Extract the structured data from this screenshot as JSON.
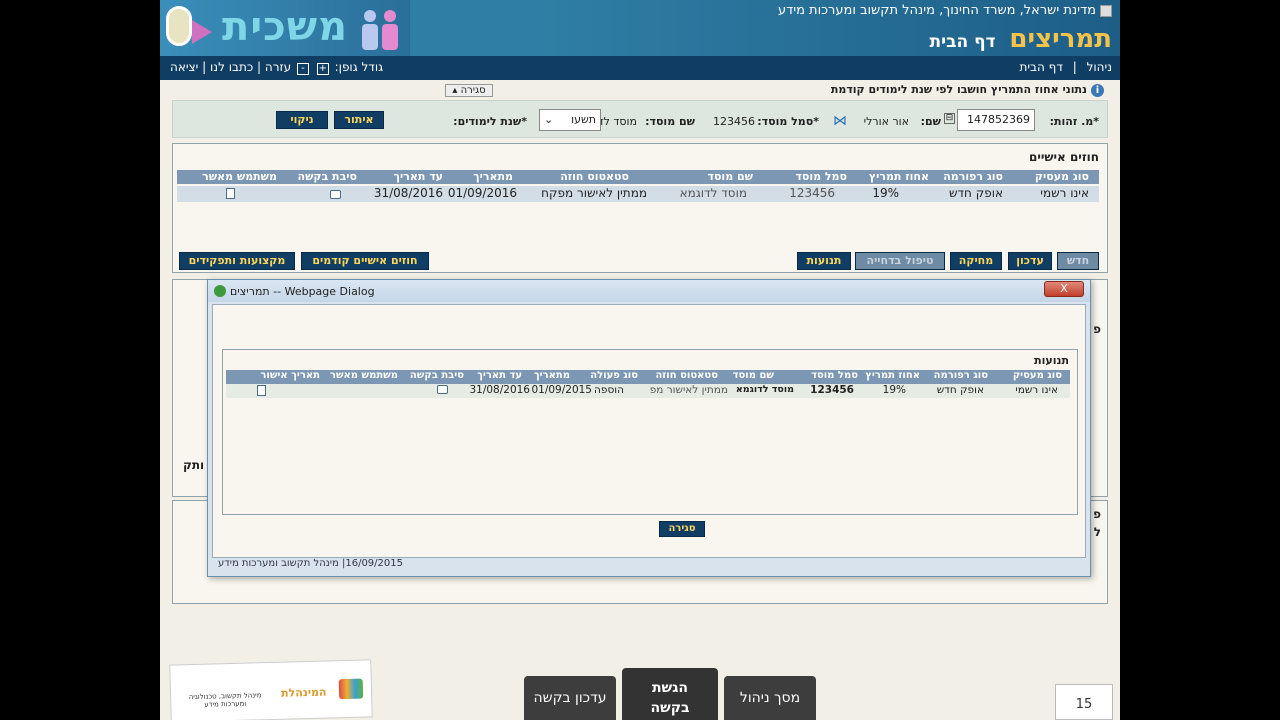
{
  "header": {
    "gov_line": "מדינת ישראל, משרד החינוך, מינהל תקשוב ומערכות מידע",
    "app_name": "תמריצים",
    "page_name": "דף הבית",
    "logo_word": "משכית"
  },
  "nav": {
    "right_items": [
      "ניהול",
      "דף הבית"
    ],
    "font_size_label": "גודל גופן:",
    "font_plus": "+",
    "font_minus": "-",
    "help": "עזרה",
    "contact": "כתבו לנו",
    "exit": "יציאה"
  },
  "info": {
    "text": "נתוני אחוז התמריץ חושבו לפי שנת לימודים קודמת",
    "close_tab": "סגירה"
  },
  "search": {
    "id_label": "מ. זהות:",
    "id_value": "147852369",
    "name_label": "שם:",
    "name_value": "אור אורלי",
    "inst_code_label": "סמל מוסד:",
    "inst_code_value": "123456",
    "inst_name_label": "שם מוסד:",
    "inst_name_value": "מוסד לדוגמא",
    "year_label": "שנת לימודים:",
    "year_value": "תשעו",
    "search_btn": "איתור",
    "clear_btn": "ניקוי"
  },
  "contracts": {
    "title": "חוזים אישיים",
    "columns": [
      "סוג מעסיק",
      "סוג רפורמה",
      "אחוז תמריץ",
      "סמל מוסד",
      "שם מוסד",
      "סטאטוס חוזה",
      "מתאריך",
      "עד תאריך",
      "סיבת בקשה",
      "משתמש מאשר"
    ],
    "row": {
      "employer": "אינו רשמי",
      "reform": "אופק חדש",
      "percent": "19%",
      "inst_code": "123456",
      "inst_name": "מוסד לדוגמא",
      "status": "ממתין לאישור מפקח",
      "from": "01/09/2016",
      "to": "31/08/2016"
    },
    "buttons": {
      "new": "חדש",
      "update": "עדכון",
      "delete": "מחיקה",
      "reject": "טיפול בדחייה",
      "movements": "תנועות",
      "previous": "חוזים אישיים קודמים",
      "professions": "מקצועות ותפקידים"
    }
  },
  "dialog": {
    "title": "תמריצים -- Webpage Dialog",
    "close_x": "X",
    "section_title": "תנועות",
    "columns": [
      "סוג מעסיק",
      "סוג רפורמה",
      "אחוז תמריץ",
      "סמל מוסד",
      "שם מוסד",
      "סטאטוס חוזה",
      "סוג פעולה",
      "מתאריך",
      "עד תאריך",
      "סיבת בקשה",
      "משתמש מאשר",
      "תאריך אישור"
    ],
    "row": {
      "employer": "אינו רשמי",
      "reform": "אופק חדש",
      "percent": "19%",
      "inst_code": "123456",
      "inst_name": "מוסד לדוגמא",
      "status": "ממתין לאישור מפ",
      "action": "הוספה",
      "from": "01/09/2015",
      "to": "31/08/2016"
    },
    "close_btn": "סגירה",
    "status_bar": "16/09/2015| מינהל תקשוב ומערכות מידע"
  },
  "bottom": {
    "tab_update": "עדכון בקשה",
    "tab_submit_line1": "הגשת",
    "tab_submit_line2": "בקשה",
    "tab_manage": "מסך ניהול",
    "page_number": "15",
    "footer_org": "המינהלת",
    "footer_sub": "מינהל תקשוב, טכנולוגיה ומערכות מידע"
  },
  "side_fragments": {
    "left_text": "ותק",
    "right_p1": "פ",
    "right_p2": "פ",
    "right_l": "ל"
  }
}
